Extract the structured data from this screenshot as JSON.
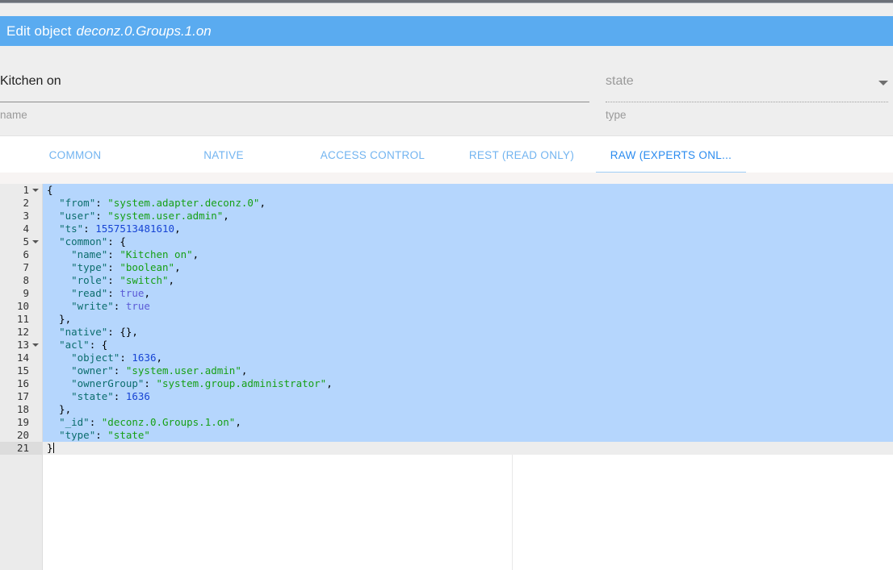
{
  "window": {
    "chrome_strip_color": "#6b7078"
  },
  "header": {
    "title_prefix": "Edit object",
    "object_id": "deconz.0.Groups.1.on",
    "background_color": "#5aabf0"
  },
  "fields": {
    "name": {
      "value": "Kitchen on",
      "hint": "name",
      "placeholder": "name"
    },
    "type": {
      "value": "state",
      "hint": "type",
      "placeholder": "state",
      "arrow_icon": "chevron-down-icon"
    }
  },
  "tabs": {
    "items": [
      {
        "label": "COMMON",
        "active": false
      },
      {
        "label": "NATIVE",
        "active": false
      },
      {
        "label": "ACCESS CONTROL",
        "active": false
      },
      {
        "label": "REST (READ ONLY)",
        "active": false
      },
      {
        "label": "RAW (EXPERTS ONL...",
        "active": true
      }
    ],
    "active_color": "#2a8bef",
    "inactive_color": "#72b4f0"
  },
  "editor": {
    "selection_color": "#b5d6fd",
    "active_line_color": "#ededed",
    "gutter_background": "#ebebeb",
    "lines": [
      {
        "num": "1",
        "fold": true,
        "selected": true,
        "active": false,
        "tokens": [
          {
            "t": "punc",
            "v": "{"
          }
        ]
      },
      {
        "num": "2",
        "fold": false,
        "selected": true,
        "active": false,
        "tokens": [
          {
            "t": "punc",
            "v": "  "
          },
          {
            "t": "key",
            "v": "\"from\""
          },
          {
            "t": "punc",
            "v": ": "
          },
          {
            "t": "str",
            "v": "\"system.adapter.deconz.0\""
          },
          {
            "t": "punc",
            "v": ","
          }
        ]
      },
      {
        "num": "3",
        "fold": false,
        "selected": true,
        "active": false,
        "tokens": [
          {
            "t": "punc",
            "v": "  "
          },
          {
            "t": "key",
            "v": "\"user\""
          },
          {
            "t": "punc",
            "v": ": "
          },
          {
            "t": "str",
            "v": "\"system.user.admin\""
          },
          {
            "t": "punc",
            "v": ","
          }
        ]
      },
      {
        "num": "4",
        "fold": false,
        "selected": true,
        "active": false,
        "tokens": [
          {
            "t": "punc",
            "v": "  "
          },
          {
            "t": "key",
            "v": "\"ts\""
          },
          {
            "t": "punc",
            "v": ": "
          },
          {
            "t": "num",
            "v": "1557513481610"
          },
          {
            "t": "punc",
            "v": ","
          }
        ]
      },
      {
        "num": "5",
        "fold": true,
        "selected": true,
        "active": false,
        "tokens": [
          {
            "t": "punc",
            "v": "  "
          },
          {
            "t": "key",
            "v": "\"common\""
          },
          {
            "t": "punc",
            "v": ": {"
          }
        ]
      },
      {
        "num": "6",
        "fold": false,
        "selected": true,
        "active": false,
        "tokens": [
          {
            "t": "punc",
            "v": "    "
          },
          {
            "t": "key",
            "v": "\"name\""
          },
          {
            "t": "punc",
            "v": ": "
          },
          {
            "t": "str",
            "v": "\"Kitchen on\""
          },
          {
            "t": "punc",
            "v": ","
          }
        ]
      },
      {
        "num": "7",
        "fold": false,
        "selected": true,
        "active": false,
        "tokens": [
          {
            "t": "punc",
            "v": "    "
          },
          {
            "t": "key",
            "v": "\"type\""
          },
          {
            "t": "punc",
            "v": ": "
          },
          {
            "t": "str",
            "v": "\"boolean\""
          },
          {
            "t": "punc",
            "v": ","
          }
        ]
      },
      {
        "num": "8",
        "fold": false,
        "selected": true,
        "active": false,
        "tokens": [
          {
            "t": "punc",
            "v": "    "
          },
          {
            "t": "key",
            "v": "\"role\""
          },
          {
            "t": "punc",
            "v": ": "
          },
          {
            "t": "str",
            "v": "\"switch\""
          },
          {
            "t": "punc",
            "v": ","
          }
        ]
      },
      {
        "num": "9",
        "fold": false,
        "selected": true,
        "active": false,
        "tokens": [
          {
            "t": "punc",
            "v": "    "
          },
          {
            "t": "key",
            "v": "\"read\""
          },
          {
            "t": "punc",
            "v": ": "
          },
          {
            "t": "bool",
            "v": "true"
          },
          {
            "t": "punc",
            "v": ","
          }
        ]
      },
      {
        "num": "10",
        "fold": false,
        "selected": true,
        "active": false,
        "tokens": [
          {
            "t": "punc",
            "v": "    "
          },
          {
            "t": "key",
            "v": "\"write\""
          },
          {
            "t": "punc",
            "v": ": "
          },
          {
            "t": "bool",
            "v": "true"
          }
        ]
      },
      {
        "num": "11",
        "fold": false,
        "selected": true,
        "active": false,
        "tokens": [
          {
            "t": "punc",
            "v": "  },"
          }
        ]
      },
      {
        "num": "12",
        "fold": false,
        "selected": true,
        "active": false,
        "tokens": [
          {
            "t": "punc",
            "v": "  "
          },
          {
            "t": "key",
            "v": "\"native\""
          },
          {
            "t": "punc",
            "v": ": {},"
          }
        ]
      },
      {
        "num": "13",
        "fold": true,
        "selected": true,
        "active": false,
        "tokens": [
          {
            "t": "punc",
            "v": "  "
          },
          {
            "t": "key",
            "v": "\"acl\""
          },
          {
            "t": "punc",
            "v": ": {"
          }
        ]
      },
      {
        "num": "14",
        "fold": false,
        "selected": true,
        "active": false,
        "tokens": [
          {
            "t": "punc",
            "v": "    "
          },
          {
            "t": "key",
            "v": "\"object\""
          },
          {
            "t": "punc",
            "v": ": "
          },
          {
            "t": "num",
            "v": "1636"
          },
          {
            "t": "punc",
            "v": ","
          }
        ]
      },
      {
        "num": "15",
        "fold": false,
        "selected": true,
        "active": false,
        "tokens": [
          {
            "t": "punc",
            "v": "    "
          },
          {
            "t": "key",
            "v": "\"owner\""
          },
          {
            "t": "punc",
            "v": ": "
          },
          {
            "t": "str",
            "v": "\"system.user.admin\""
          },
          {
            "t": "punc",
            "v": ","
          }
        ]
      },
      {
        "num": "16",
        "fold": false,
        "selected": true,
        "active": false,
        "tokens": [
          {
            "t": "punc",
            "v": "    "
          },
          {
            "t": "key",
            "v": "\"ownerGroup\""
          },
          {
            "t": "punc",
            "v": ": "
          },
          {
            "t": "str",
            "v": "\"system.group.administrator\""
          },
          {
            "t": "punc",
            "v": ","
          }
        ]
      },
      {
        "num": "17",
        "fold": false,
        "selected": true,
        "active": false,
        "tokens": [
          {
            "t": "punc",
            "v": "    "
          },
          {
            "t": "key",
            "v": "\"state\""
          },
          {
            "t": "punc",
            "v": ": "
          },
          {
            "t": "num",
            "v": "1636"
          }
        ]
      },
      {
        "num": "18",
        "fold": false,
        "selected": true,
        "active": false,
        "tokens": [
          {
            "t": "punc",
            "v": "  },"
          }
        ]
      },
      {
        "num": "19",
        "fold": false,
        "selected": true,
        "active": false,
        "tokens": [
          {
            "t": "punc",
            "v": "  "
          },
          {
            "t": "key",
            "v": "\"_id\""
          },
          {
            "t": "punc",
            "v": ": "
          },
          {
            "t": "str",
            "v": "\"deconz.0.Groups.1.on\""
          },
          {
            "t": "punc",
            "v": ","
          }
        ]
      },
      {
        "num": "20",
        "fold": false,
        "selected": true,
        "active": false,
        "tokens": [
          {
            "t": "punc",
            "v": "  "
          },
          {
            "t": "key",
            "v": "\"type\""
          },
          {
            "t": "punc",
            "v": ": "
          },
          {
            "t": "str",
            "v": "\"state\""
          }
        ]
      },
      {
        "num": "21",
        "fold": false,
        "selected": false,
        "active": true,
        "caret": true,
        "tokens": [
          {
            "t": "punc",
            "v": "}"
          }
        ]
      }
    ]
  }
}
